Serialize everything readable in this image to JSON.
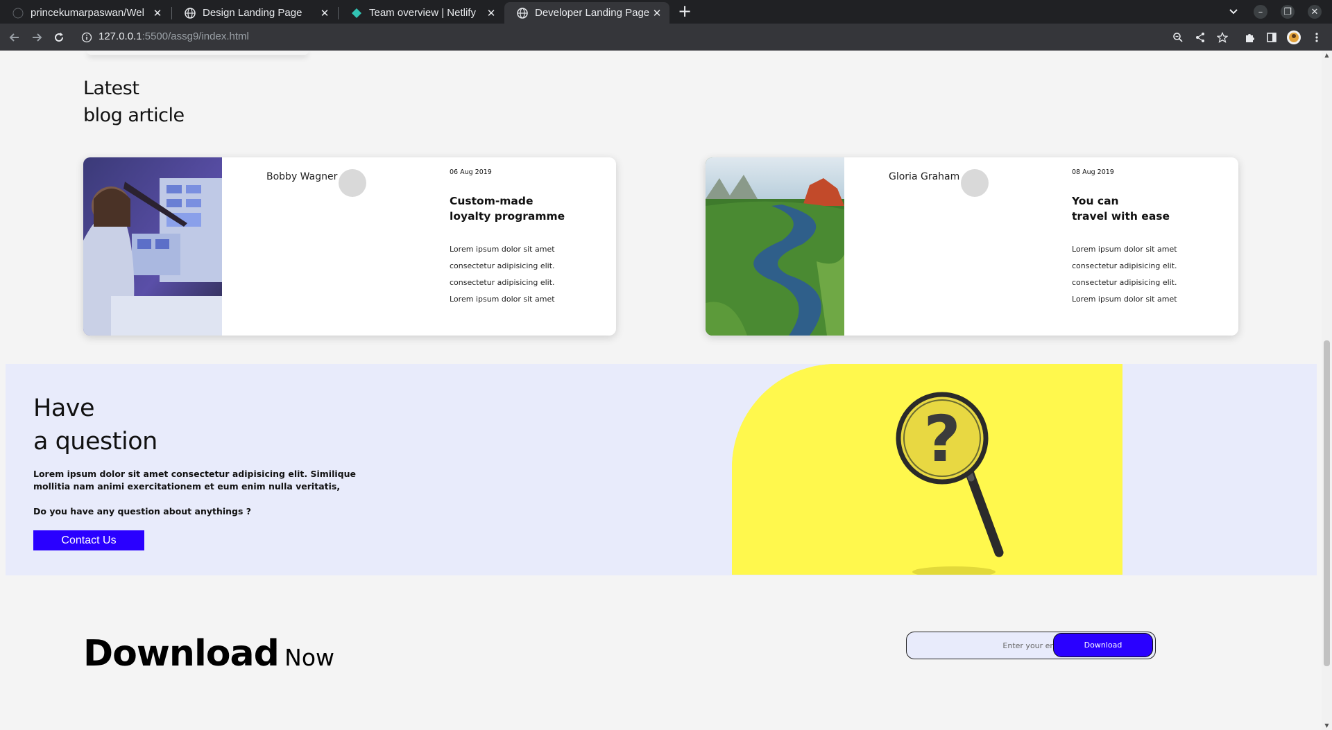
{
  "browser": {
    "tabs": [
      {
        "title": "princekumarpaswan/Wel",
        "active": false
      },
      {
        "title": "Design Landing Page",
        "active": false
      },
      {
        "title": "Team overview | Netlify",
        "active": false
      },
      {
        "title": "Developer Landing Page",
        "active": true
      }
    ],
    "url_host": "127.0.0.1",
    "url_path": ":5500/assg9/index.html"
  },
  "blog": {
    "heading_line1": "Latest",
    "heading_line2": "blog article",
    "cards": [
      {
        "author": "Bobby Wagner",
        "date": "06 Aug 2019",
        "title_line1": "Custom-made",
        "title_line2": "loyalty programme",
        "body": [
          "Lorem ipsum dolor sit amet",
          "consectetur adipisicing elit.",
          "consectetur adipisicing elit.",
          "Lorem ipsum dolor sit amet"
        ]
      },
      {
        "author": "Gloria Graham",
        "date": "08 Aug 2019",
        "title_line1": "You can",
        "title_line2": "travel with ease",
        "body": [
          "Lorem ipsum dolor sit amet",
          "consectetur adipisicing elit.",
          "consectetur adipisicing elit.",
          "Lorem ipsum dolor sit amet"
        ]
      }
    ]
  },
  "question": {
    "title_line1": "Have",
    "title_line2": "a question",
    "body": "Lorem ipsum dolor sit amet consectetur adipisicing elit. Similique mollitia nam animi exercitationem et eum enim nulla veritatis,",
    "ask": "Do you have any question about anythings ?",
    "button_label": "Contact Us"
  },
  "download": {
    "title_big": "Download",
    "title_small": "Now",
    "email_placeholder": "Enter your email",
    "button_label": "Download"
  },
  "colors": {
    "accent": "#2a00ff",
    "question_bg": "#e8ebfb",
    "yellow": "#fff84d"
  }
}
